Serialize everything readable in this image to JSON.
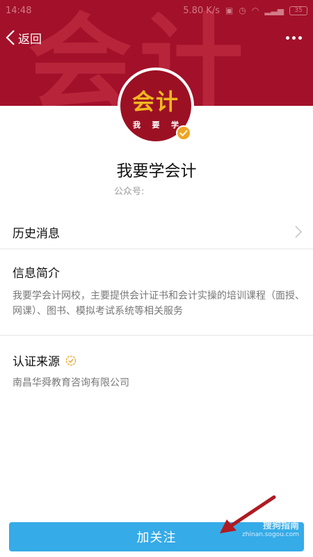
{
  "status_bar": {
    "time": "14:48",
    "speed": "5.80 K/s",
    "battery": "35"
  },
  "banner": {
    "watermark_text": "会计"
  },
  "nav": {
    "back_label": "返回"
  },
  "avatar": {
    "main_text": "会计",
    "sub_chars": [
      "我",
      "要",
      "学"
    ]
  },
  "account": {
    "name": "我要学会计",
    "id_label": "公众号:"
  },
  "history": {
    "label": "历史消息"
  },
  "intro": {
    "title": "信息简介",
    "text": "我要学会计网校，主要提供会计证书和会计实操的培训课程（面授、网课）、图书、模拟考试系统等相关服务"
  },
  "certification": {
    "title": "认证来源",
    "source": "南昌华舜教育咨询有限公司"
  },
  "follow_button": {
    "label": "加关注"
  },
  "watermark": {
    "brand": "搜狗指南",
    "url": "zhinan.sogou.com"
  },
  "colors": {
    "banner": "#a3102a",
    "accent_button": "#35abe8",
    "badge": "#f0a424"
  }
}
